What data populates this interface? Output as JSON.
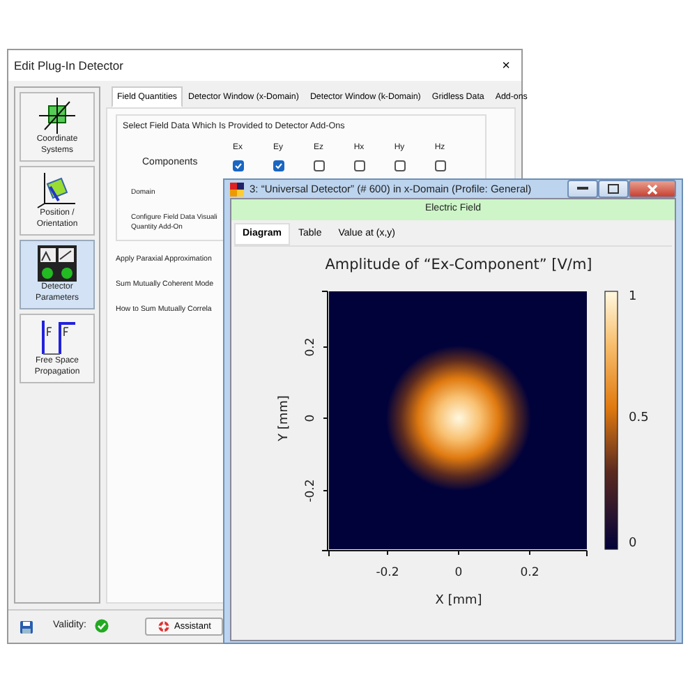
{
  "dialog": {
    "title": "Edit Plug-In Detector",
    "close": "×",
    "sidebar": [
      {
        "kind": "axes",
        "label": "Coordinate Systems",
        "selected": false
      },
      {
        "kind": "orientation",
        "label": "Position / Orientation",
        "selected": false
      },
      {
        "kind": "detector",
        "label": "Detector Parameters",
        "selected": true
      },
      {
        "kind": "propagation",
        "label": "Free Space Propagation",
        "selected": false
      }
    ],
    "tabs": [
      {
        "label": "Field Quantities",
        "selected": true
      },
      {
        "label": "Detector Window (x-Domain)",
        "selected": false
      },
      {
        "label": "Detector Window (k-Domain)",
        "selected": false
      },
      {
        "label": "Gridless Data",
        "selected": false
      },
      {
        "label": "Add-ons",
        "selected": false
      }
    ],
    "group_title": "Select Field Data Which Is Provided to Detector Add-Ons",
    "components_label": "Components",
    "components": [
      {
        "label": "Ex",
        "checked": true
      },
      {
        "label": "Ey",
        "checked": true
      },
      {
        "label": "Ez",
        "checked": false
      },
      {
        "label": "Hx",
        "checked": false
      },
      {
        "label": "Hy",
        "checked": false
      },
      {
        "label": "Hz",
        "checked": false
      }
    ],
    "group_rows": [
      "Domain",
      "Configure Field Data Visuali\nQuantity Add-On"
    ],
    "rows": [
      "Apply Paraxial Approximation",
      "Sum Mutually Coherent Mode",
      "How to Sum Mutually Correla"
    ],
    "validity_label": "Validity:",
    "valid": true,
    "assistant": "Assistant"
  },
  "viewer": {
    "title": "3: “Universal Detector” (# 600) in x-Domain (Profile: General)",
    "banner": "Electric Field",
    "tabs": [
      {
        "label": "Diagram",
        "selected": true
      },
      {
        "label": "Table",
        "selected": false
      },
      {
        "label": "Value at (x,y)",
        "selected": false
      }
    ],
    "plot": {
      "title": "Amplitude of “Ex-Component”  [V/m]",
      "xlabel": "X [mm]",
      "ylabel": "Y [mm]",
      "xticks": [
        "-0.2",
        "0",
        "0.2"
      ],
      "yticks": [
        "0.2",
        "0",
        "-0.2"
      ],
      "colorbar_ticks": [
        "1",
        "0.5",
        "0"
      ]
    }
  }
}
